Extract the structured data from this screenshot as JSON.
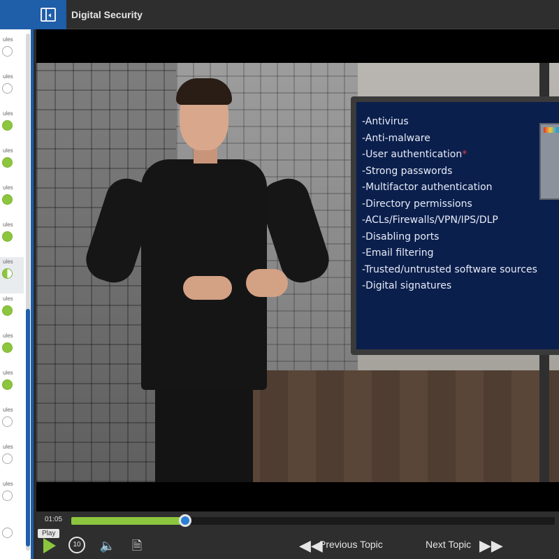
{
  "header": {
    "title": "Digital Security",
    "menu_icon": "sidebar-toggle-icon"
  },
  "sidebar": {
    "items": [
      {
        "label": "ules",
        "status": "empty"
      },
      {
        "label": "ules",
        "status": "empty"
      },
      {
        "label": "ules",
        "status": "done"
      },
      {
        "label": "ules",
        "status": "done"
      },
      {
        "label": "ules",
        "status": "done"
      },
      {
        "label": "ules",
        "status": "done"
      },
      {
        "label": "ules",
        "status": "half"
      },
      {
        "label": "ules",
        "status": "done"
      },
      {
        "label": "ules",
        "status": "done"
      },
      {
        "label": "ules",
        "status": "done"
      },
      {
        "label": "ules",
        "status": "empty"
      },
      {
        "label": "ules",
        "status": "empty"
      },
      {
        "label": "ules",
        "status": "empty"
      },
      {
        "label": "",
        "status": "empty"
      }
    ]
  },
  "video": {
    "slide_items": [
      "Antivirus",
      "Anti-malware",
      "User authentication",
      "Strong passwords",
      "Multifactor authentication",
      "Directory permissions",
      "ACLs/Firewalls/VPN/IPS/DLP",
      "Disabling ports",
      "Email filtering",
      "Trusted/untrusted software sources",
      "Digital signatures"
    ],
    "slide_marker": "*"
  },
  "player": {
    "time": "01:05",
    "progress_fraction": 0.236,
    "play_tooltip": "Play",
    "play_icon": "play-icon",
    "replay_icon": "replay-icon",
    "replay_text": "10",
    "volume_icon": "volume-icon",
    "notes_icon": "transcript-icon",
    "prev_label": "Previous Topic",
    "next_label": "Next Topic"
  },
  "colors": {
    "accent_blue": "#1f5ea8",
    "progress_green": "#8cc63f",
    "slide_bg": "#0b1f4d"
  }
}
